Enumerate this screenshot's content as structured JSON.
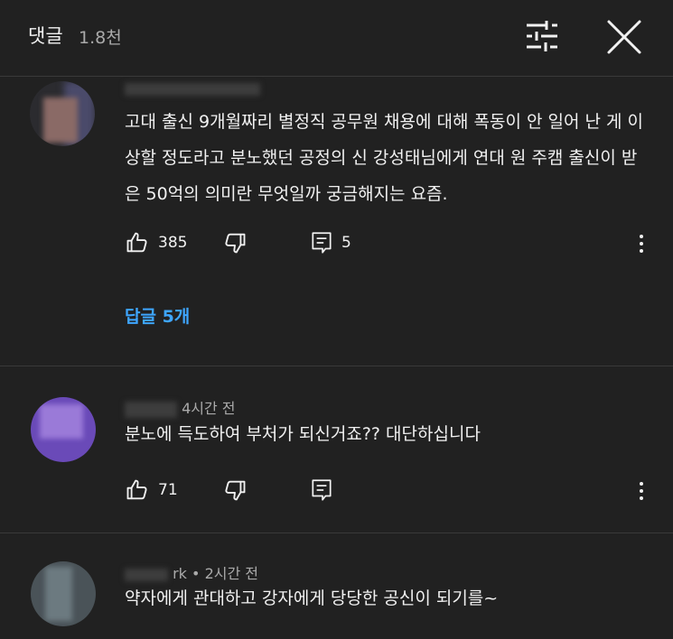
{
  "header": {
    "title": "댓글",
    "count": "1.8천",
    "filter_icon": "filter-sliders-icon",
    "close_icon": "close-icon"
  },
  "comments": [
    {
      "time": "",
      "text": "고대 출신 9개월짜리 별정직 공무원 채용에 대해 폭동이 안 일어 난 게 이상할 정도라고 분노했던 공정의 신 강성태님에게 연대 원 주캠 출신이 받은 50억의 의미란 무엇일까 궁금해지는 요즘.",
      "likes": "385",
      "replies_count": "5",
      "replies_link": "답글 5개"
    },
    {
      "time": "4시간 전",
      "text": "분노에 득도하여 부처가 되신거죠?? 대단하십니다",
      "likes": "71",
      "replies_count": ""
    },
    {
      "author_partial": "rk",
      "separator": "•",
      "time": "2시간 전",
      "text": "약자에게 관대하고 강자에게 당당한 공신이 되기를~"
    }
  ],
  "colors": {
    "background": "#212121",
    "text": "#f1f1f1",
    "secondary": "#aaaaaa",
    "link": "#3ea6ff"
  }
}
